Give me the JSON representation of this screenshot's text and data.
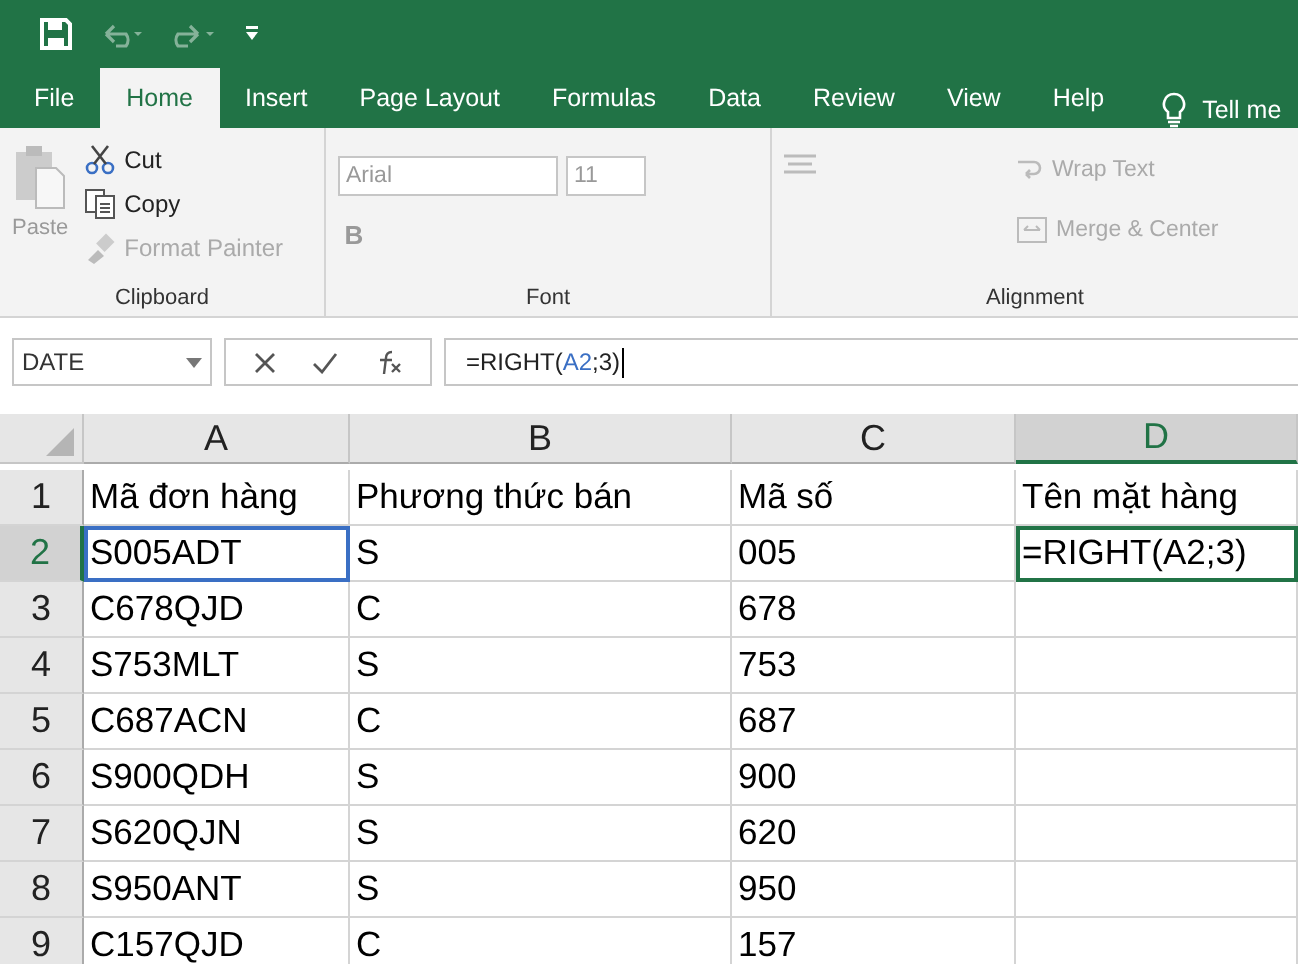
{
  "quick_access": [
    {
      "kind": "save",
      "disabled": false
    },
    {
      "kind": "undo",
      "disabled": true
    },
    {
      "kind": "redo",
      "disabled": true
    },
    {
      "kind": "customize",
      "disabled": false
    }
  ],
  "tabs": [
    {
      "label": "File",
      "selected": false
    },
    {
      "label": "Home",
      "selected": true
    },
    {
      "label": "Insert",
      "selected": false
    },
    {
      "label": "Page Layout",
      "selected": false
    },
    {
      "label": "Formulas",
      "selected": false
    },
    {
      "label": "Data",
      "selected": false
    },
    {
      "label": "Review",
      "selected": false
    },
    {
      "label": "View",
      "selected": false
    },
    {
      "label": "Help",
      "selected": false
    }
  ],
  "tell_me": "Tell me",
  "clipboard": {
    "paste": {
      "label": "Paste",
      "disabled": true
    },
    "items": [
      {
        "kind": "cut",
        "label": "Cut",
        "disabled": false
      },
      {
        "kind": "copy",
        "label": "Copy",
        "disabled": false
      },
      {
        "kind": "painter",
        "label": "Format Painter",
        "disabled": true
      }
    ],
    "title": "Clipboard"
  },
  "font": {
    "name": "Arial",
    "size": "11",
    "bold": "B",
    "title": "Font"
  },
  "alignment": {
    "wrap": "Wrap Text",
    "merge": "Merge & Center",
    "title": "Alignment"
  },
  "name_box": "DATE",
  "formula_parts": [
    {
      "text": "=RIGHT(",
      "kind": "plain"
    },
    {
      "text": "A2",
      "kind": "reference"
    },
    {
      "text": ";3)",
      "kind": "plain"
    }
  ],
  "columns": [
    {
      "label": "A",
      "selected": false
    },
    {
      "label": "B",
      "selected": false
    },
    {
      "label": "C",
      "selected": false
    },
    {
      "label": "D",
      "selected": true
    }
  ],
  "rows": [
    {
      "number": "1",
      "selected": false,
      "cells": [
        {
          "text": "Mã đơn hàng",
          "referenced": false,
          "editing": false
        },
        {
          "text": "Phương thức bán",
          "referenced": false,
          "editing": false
        },
        {
          "text": "Mã số",
          "referenced": false,
          "editing": false
        },
        {
          "text": "Tên mặt hàng",
          "referenced": false,
          "editing": false
        }
      ]
    },
    {
      "number": "2",
      "selected": true,
      "cells": [
        {
          "text": "S005ADT",
          "referenced": true,
          "editing": false
        },
        {
          "text": "S",
          "referenced": false,
          "editing": false
        },
        {
          "text": "005",
          "referenced": false,
          "editing": false
        },
        {
          "text": "=RIGHT(A2;3)",
          "referenced": false,
          "editing": true
        }
      ]
    },
    {
      "number": "3",
      "selected": false,
      "cells": [
        {
          "text": "C678QJD",
          "referenced": false,
          "editing": false
        },
        {
          "text": "C",
          "referenced": false,
          "editing": false
        },
        {
          "text": "678",
          "referenced": false,
          "editing": false
        }
      ]
    },
    {
      "number": "4",
      "selected": false,
      "cells": [
        {
          "text": "S753MLT",
          "referenced": false,
          "editing": false
        },
        {
          "text": "S",
          "referenced": false,
          "editing": false
        },
        {
          "text": "753",
          "referenced": false,
          "editing": false
        }
      ]
    },
    {
      "number": "5",
      "selected": false,
      "cells": [
        {
          "text": "C687ACN",
          "referenced": false,
          "editing": false
        },
        {
          "text": "C",
          "referenced": false,
          "editing": false
        },
        {
          "text": "687",
          "referenced": false,
          "editing": false
        }
      ]
    },
    {
      "number": "6",
      "selected": false,
      "cells": [
        {
          "text": "S900QDH",
          "referenced": false,
          "editing": false
        },
        {
          "text": "S",
          "referenced": false,
          "editing": false
        },
        {
          "text": "900",
          "referenced": false,
          "editing": false
        }
      ]
    },
    {
      "number": "7",
      "selected": false,
      "cells": [
        {
          "text": "S620QJN",
          "referenced": false,
          "editing": false
        },
        {
          "text": "S",
          "referenced": false,
          "editing": false
        },
        {
          "text": "620",
          "referenced": false,
          "editing": false
        }
      ]
    },
    {
      "number": "8",
      "selected": false,
      "cells": [
        {
          "text": "S950ANT",
          "referenced": false,
          "editing": false
        },
        {
          "text": "S",
          "referenced": false,
          "editing": false
        },
        {
          "text": "950",
          "referenced": false,
          "editing": false
        }
      ]
    },
    {
      "number": "9",
      "selected": false,
      "cells": [
        {
          "text": "C157QJD",
          "referenced": false,
          "editing": false
        },
        {
          "text": "C",
          "referenced": false,
          "editing": false
        },
        {
          "text": "157",
          "referenced": false,
          "editing": false
        }
      ]
    }
  ]
}
